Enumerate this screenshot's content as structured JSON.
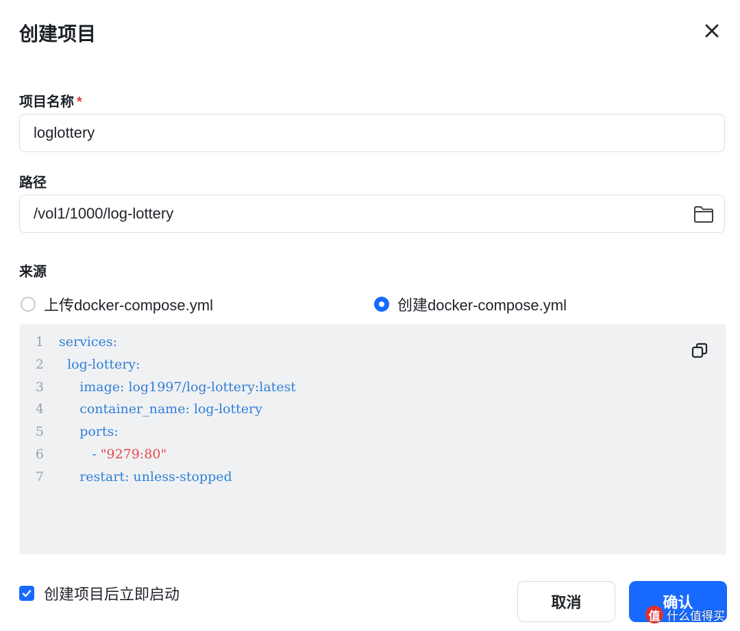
{
  "dialog": {
    "title": "创建项目",
    "close_icon": "close-icon"
  },
  "project_name": {
    "label": "项目名称",
    "required_mark": "*",
    "value": "loglottery"
  },
  "path": {
    "label": "路径",
    "value": "/vol1/1000/log-lottery",
    "icon": "folder-icon"
  },
  "source": {
    "label": "来源",
    "options": [
      {
        "label": "上传docker-compose.yml",
        "selected": false
      },
      {
        "label": "创建docker-compose.yml",
        "selected": true
      }
    ]
  },
  "editor": {
    "copy_icon": "copy-icon",
    "lines": [
      {
        "num": "1",
        "text": "services:"
      },
      {
        "num": "2",
        "text": "  log-lottery:"
      },
      {
        "num": "3",
        "text": "     image: log1997/log-lottery:latest"
      },
      {
        "num": "4",
        "text": "     container_name: log-lottery"
      },
      {
        "num": "5",
        "text": "     ports:"
      },
      {
        "num": "6",
        "text": "        - ",
        "string": "\"9279:80\""
      },
      {
        "num": "7",
        "text": "     restart: unless-stopped"
      }
    ]
  },
  "footer": {
    "start_after_create": {
      "label": "创建项目后立即启动",
      "checked": true
    },
    "cancel_label": "取消",
    "confirm_label": "确认"
  },
  "watermark": {
    "badge": "值",
    "text": "什么值得买"
  },
  "colors": {
    "primary": "#1769ff",
    "code_text": "#2f7fd6",
    "code_string": "#e5484d",
    "required": "#e53935",
    "editor_bg": "#f0f1f3"
  }
}
